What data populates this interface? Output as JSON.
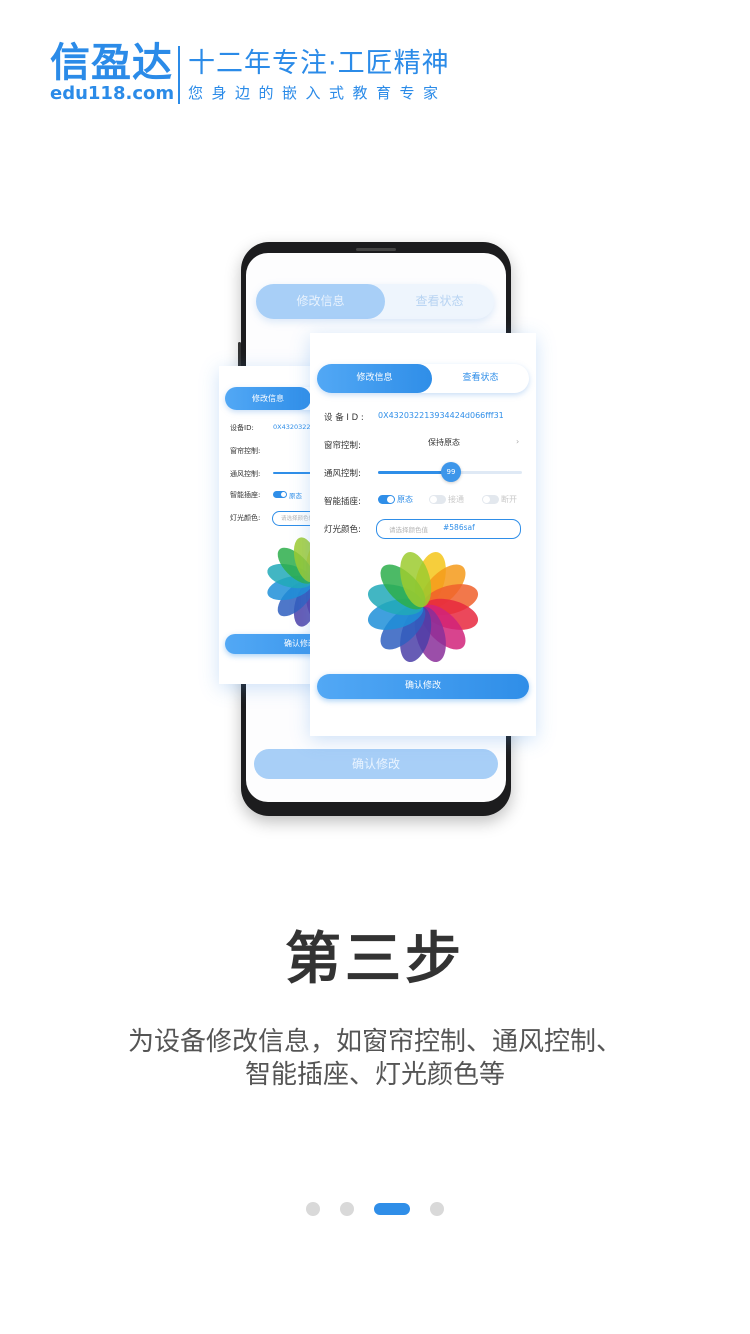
{
  "brand": {
    "name": "信盈达",
    "url": "edu118.com",
    "slogan": "十二年专注·工匠精神",
    "tagline": "您身边的嵌入式教育专家",
    "color": "#2b8be8"
  },
  "phone": {
    "tabs": {
      "active": "修改信息",
      "inactive": "查看状态"
    },
    "confirm": "确认修改"
  },
  "back_card": {
    "tab_active": "修改信息",
    "device_id_label": "设备ID:",
    "device_id_value": "0X432032213934424d066fff31",
    "curtain_label": "窗帘控制:",
    "vent_label": "通风控制:",
    "socket_label": "智能插座:",
    "socket_option": "原态",
    "light_label": "灯光颜色:",
    "light_placeholder": "请选择颜色值",
    "confirm": "确认修改"
  },
  "front_card": {
    "tabs": {
      "active": "修改信息",
      "inactive": "查看状态"
    },
    "device_id_label": "设 备 I D :",
    "device_id_value": "0X432032213934424d066fff31",
    "curtain_label": "窗帘控制:",
    "curtain_value": "保持原态",
    "vent_label": "通风控制:",
    "vent_value": "99",
    "vent_level_fraction": 0.5,
    "socket_label": "智能插座:",
    "socket_options": [
      "原态",
      "接通",
      "断开"
    ],
    "light_label": "灯光颜色:",
    "light_placeholder": "请选择颜色值",
    "light_value": "#586saf",
    "confirm": "确认修改"
  },
  "step": {
    "title": "第三步",
    "description_line1": "为设备修改信息，如窗帘控制、通风控制、",
    "description_line2": "智能插座、灯光颜色等"
  },
  "pager": {
    "total": 4,
    "active_index": 2
  },
  "colors": {
    "accent": "#2f8ee8",
    "text": "#333333"
  }
}
